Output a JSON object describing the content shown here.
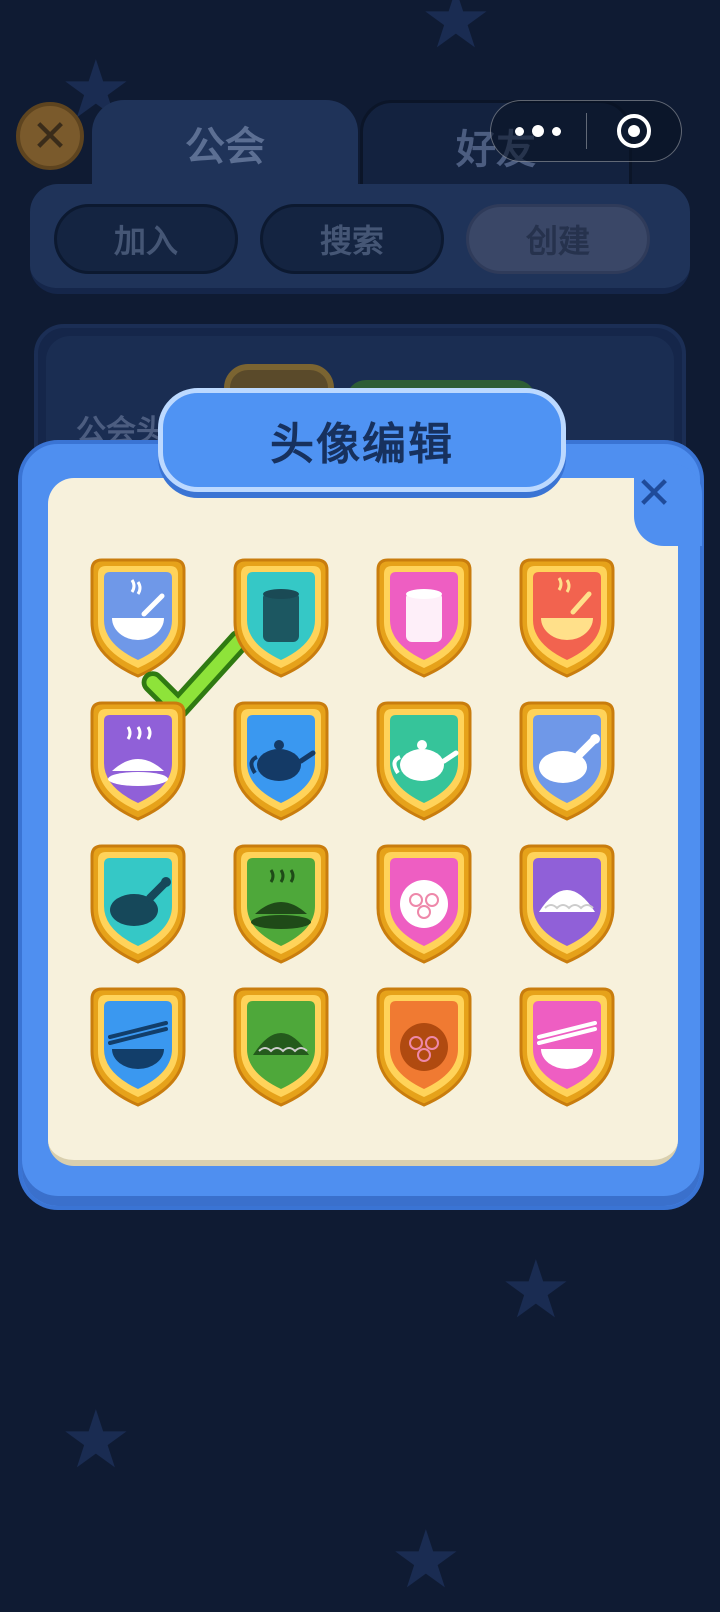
{
  "background": {
    "tabs": [
      {
        "label": "公会",
        "active": true
      },
      {
        "label": "好友",
        "active": false
      }
    ],
    "buttons": [
      {
        "label": "加入"
      },
      {
        "label": "搜索"
      },
      {
        "label": "创建",
        "selected": true
      }
    ],
    "card_label": "公会头"
  },
  "dialog": {
    "title": "头像编辑",
    "close_icon": "close-icon",
    "selected_index": 0,
    "avatars": [
      {
        "icon": "rice-bowl-icon",
        "color": "#6f98e8"
      },
      {
        "icon": "cup-icon",
        "color": "#35c8c6"
      },
      {
        "icon": "cup-icon",
        "color": "#ee5ec2"
      },
      {
        "icon": "noodle-bowl-icon",
        "color": "#f2634f"
      },
      {
        "icon": "fish-dish-icon",
        "color": "#9060d8"
      },
      {
        "icon": "teapot-icon",
        "color": "#3a98f0"
      },
      {
        "icon": "teapot-icon",
        "color": "#36c49a"
      },
      {
        "icon": "roast-chicken-icon",
        "color": "#6f98e8"
      },
      {
        "icon": "roast-chicken-icon",
        "color": "#35c8c6"
      },
      {
        "icon": "fish-dish-icon",
        "color": "#4ea83a"
      },
      {
        "icon": "steamed-bun-icon",
        "color": "#ee5ec2"
      },
      {
        "icon": "dumpling-icon",
        "color": "#9060d8"
      },
      {
        "icon": "chopsticks-bowl-icon",
        "color": "#3a98f0"
      },
      {
        "icon": "dumpling-icon",
        "color": "#4ea83a"
      },
      {
        "icon": "steamed-bun-icon",
        "color": "#f07a32"
      },
      {
        "icon": "chopsticks-bowl-icon",
        "color": "#ee5ec2"
      }
    ]
  }
}
